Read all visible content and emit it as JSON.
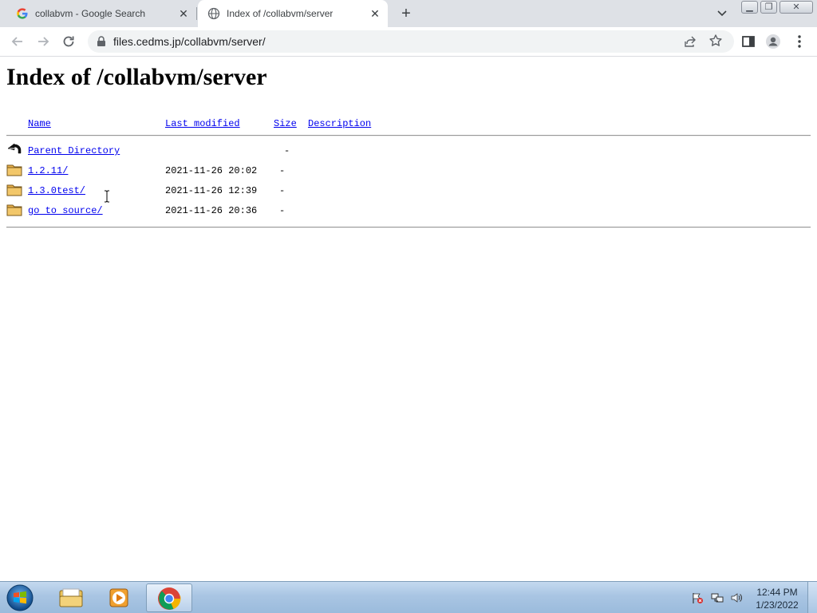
{
  "browser": {
    "tabs": [
      {
        "title": "collabvm - Google Search",
        "favicon": "google-g-icon",
        "active": false
      },
      {
        "title": "Index of /collabvm/server",
        "favicon": "globe-icon",
        "active": true
      }
    ],
    "address": {
      "url": "files.cedms.jp/collabvm/server/"
    }
  },
  "page": {
    "title": "Index of /collabvm/server",
    "headers": {
      "name": "Name",
      "modified": "Last modified",
      "size": "Size",
      "description": "Description"
    },
    "rows": [
      {
        "name": "Parent Directory",
        "modified": "",
        "size": "-",
        "icon": "back-arrow-icon"
      },
      {
        "name": "1.2.11/",
        "modified": "2021-11-26 20:02",
        "size": "-",
        "icon": "folder-icon"
      },
      {
        "name": "1.3.0test/",
        "modified": "2021-11-26 12:39",
        "size": "-",
        "icon": "folder-icon"
      },
      {
        "name": "go to source/",
        "modified": "2021-11-26 20:36",
        "size": "-",
        "icon": "folder-icon"
      }
    ]
  },
  "taskbar": {
    "clock": {
      "time": "12:44 PM",
      "date": "1/23/2022"
    },
    "pinned": [
      "explorer-icon",
      "media-player-icon",
      "chrome-icon"
    ]
  },
  "colors": {
    "link": "#0000ee",
    "tabstrip": "#dee1e6",
    "taskbar": "#a9c5e3"
  }
}
